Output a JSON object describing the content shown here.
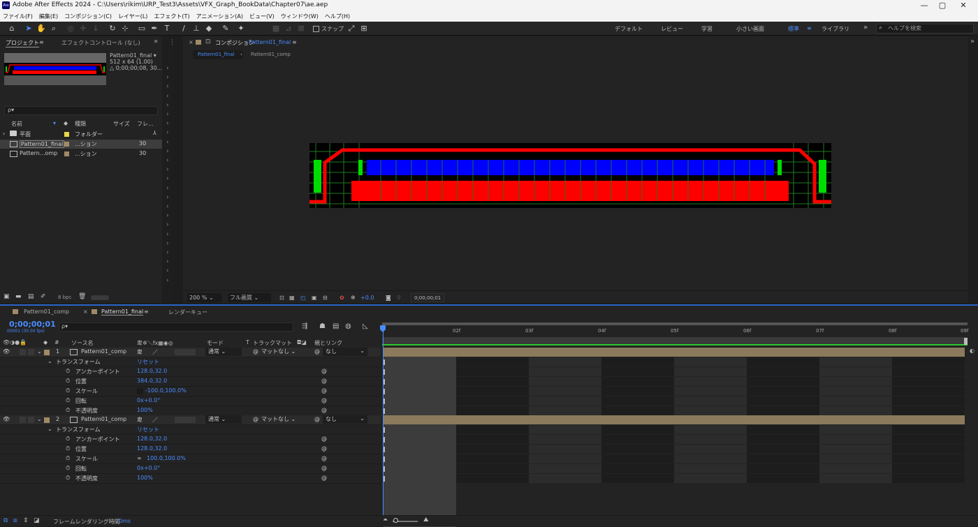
{
  "window": {
    "app_icon": "Ae",
    "title": "Adobe After Effects 2024 - C:\\Users\\rikim\\URP_Test3\\Assets\\VFX_Graph_BookData\\Chapter07\\ae.aep",
    "controls": [
      "—",
      "▢",
      "✕"
    ]
  },
  "menu": [
    "ファイル(F)",
    "編集(E)",
    "コンポジション(C)",
    "レイヤー(L)",
    "エフェクト(T)",
    "アニメーション(A)",
    "ビュー(V)",
    "ウィンドウ(W)",
    "ヘルプ(H)"
  ],
  "toolbar": {
    "snap_label": "スナップ",
    "workspaces": [
      "デフォルト",
      "レビュー",
      "学習",
      "小さい画面",
      "標準",
      "ライブラリ"
    ],
    "active_workspace": "標準",
    "more": "»",
    "help_search_placeholder": "ヘルプを検索"
  },
  "project": {
    "tab_project": "プロジェクト",
    "tab_effects": "エフェクトコントロール (なし)",
    "selected_name": "Pattern01_final ▾",
    "selected_size": "512 x 64 (1.00)",
    "selected_duration": "△ 0;00;00;08, 30...",
    "search_placeholder": "ρ▾",
    "columns": [
      "名前",
      "種類",
      "サイズ",
      "フレ..."
    ],
    "items": [
      {
        "name": "平面",
        "type": "フォルダー",
        "rate": "",
        "color": "#e8d84a",
        "kind": "folder",
        "selected": false
      },
      {
        "name": "Pattern01_final",
        "type": "...ション",
        "rate": "30",
        "color": "#a08a66",
        "kind": "comp",
        "selected": true
      },
      {
        "name": "Pattern...omp",
        "type": "...ション",
        "rate": "30",
        "color": "#a08a66",
        "kind": "comp",
        "selected": false
      }
    ],
    "bpc": "8 bpc"
  },
  "composition": {
    "panel_title": "コンポジション",
    "comp_name": "Pattern01_final",
    "breadcrumb": [
      "Pattern01_final",
      "Pattern01_comp"
    ],
    "zoom": "200 %",
    "resolution": "フル画質",
    "exposure": "+0.0",
    "timecode": "0;00;00;01"
  },
  "timeline": {
    "tabs": [
      "Pattern01_comp",
      "Pattern01_final",
      "レンダーキュー"
    ],
    "active_tab": "Pattern01_final",
    "timecode": "0;00;00;01",
    "timecode_sub": "00001 (30.00 fps)",
    "search_placeholder": "ρ▾",
    "headers": {
      "source": "ソース名",
      "mode": "モード",
      "t": "T",
      "trackmatte": "トラックマット",
      "parent": "親とリンク"
    },
    "ruler": [
      "02f",
      "03f",
      "04f",
      "05f",
      "06f",
      "07f",
      "08f",
      "09f"
    ],
    "layers": [
      {
        "index": "1",
        "name": "Pattern01_comp",
        "mode": "通常",
        "matte": "マットなし",
        "parent": "なし",
        "transform_label": "トランスフォーム",
        "reset": "リセット",
        "props": [
          {
            "name": "アンカーポイント",
            "value": "128.0,32.0"
          },
          {
            "name": "位置",
            "value": "384.0,32.0"
          },
          {
            "name": "スケール",
            "value": "-100.0,100.0%"
          },
          {
            "name": "回転",
            "value": "0x+0.0°"
          },
          {
            "name": "不透明度",
            "value": "100%"
          }
        ]
      },
      {
        "index": "2",
        "name": "Pattern01_comp",
        "mode": "通常",
        "matte": "マットなし",
        "parent": "なし",
        "transform_label": "トランスフォーム",
        "reset": "リセット",
        "props": [
          {
            "name": "アンカーポイント",
            "value": "128.0,32.0"
          },
          {
            "name": "位置",
            "value": "128.0,32.0"
          },
          {
            "name": "スケール",
            "value": "100.0,100.0%"
          },
          {
            "name": "回転",
            "value": "0x+0.0°"
          },
          {
            "name": "不透明度",
            "value": "100%"
          }
        ]
      }
    ],
    "render_time_label": "フレームレンダリング時間",
    "render_time": "0ms"
  },
  "colors": {
    "accent": "#4a8cff",
    "layer_label": "#a08a66",
    "canvas_red": "#ff0000",
    "canvas_blue": "#0000ff",
    "canvas_green": "#00dd00"
  }
}
